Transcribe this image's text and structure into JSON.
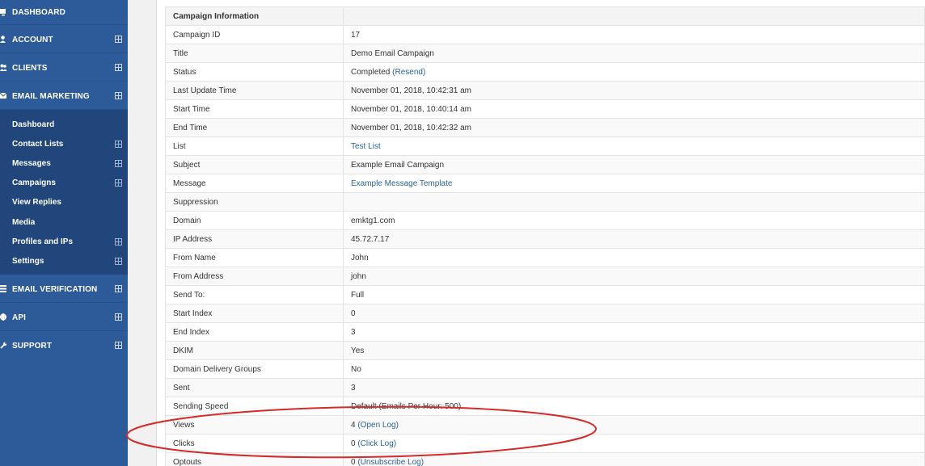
{
  "sidebar": {
    "top_items": [
      {
        "label": "DASHBOARD"
      },
      {
        "label": "ACCOUNT"
      },
      {
        "label": "CLIENTS"
      },
      {
        "label": "EMAIL MARKETING"
      }
    ],
    "sub_items": [
      {
        "label": "Dashboard"
      },
      {
        "label": "Contact Lists"
      },
      {
        "label": "Messages"
      },
      {
        "label": "Campaigns"
      },
      {
        "label": "View Replies"
      },
      {
        "label": "Media"
      },
      {
        "label": "Profiles and IPs"
      },
      {
        "label": "Settings"
      }
    ],
    "bottom_items": [
      {
        "label": "EMAIL VERIFICATION"
      },
      {
        "label": "API"
      },
      {
        "label": "SUPPORT"
      }
    ]
  },
  "campaign": {
    "header": "Campaign Information",
    "rows": [
      {
        "key": "Campaign ID",
        "value": "17"
      },
      {
        "key": "Title",
        "value": "Demo Email Campaign"
      },
      {
        "key": "Status",
        "value": "Completed",
        "link": "(Resend)"
      },
      {
        "key": "Last Update Time",
        "value": "November 01, 2018, 10:42:31 am"
      },
      {
        "key": "Start Time",
        "value": "November 01, 2018, 10:40:14 am"
      },
      {
        "key": "End Time",
        "value": "November 01, 2018, 10:42:32 am"
      },
      {
        "key": "List",
        "link": "Test List"
      },
      {
        "key": "Subject",
        "value": "Example Email Campaign"
      },
      {
        "key": "Message",
        "link": "Example Message Template"
      },
      {
        "key": "Suppression",
        "value": ""
      },
      {
        "key": "Domain",
        "value": "emktg1.com"
      },
      {
        "key": "IP Address",
        "value": "45.72.7.17"
      },
      {
        "key": "From Name",
        "value": "John"
      },
      {
        "key": "From Address",
        "value": "john"
      },
      {
        "key": "Send To:",
        "value": "Full"
      },
      {
        "key": "Start Index",
        "value": "0"
      },
      {
        "key": "End Index",
        "value": "3"
      },
      {
        "key": "DKIM",
        "value": "Yes"
      },
      {
        "key": "Domain Delivery Groups",
        "value": "No"
      },
      {
        "key": "Sent",
        "value": "3"
      },
      {
        "key": "Sending Speed",
        "value": "Default (Emails Per Hour: 500)"
      },
      {
        "key": "Views",
        "value": "4",
        "link": "(Open Log)"
      },
      {
        "key": "Clicks",
        "value": "0",
        "link": "(Click Log)"
      },
      {
        "key": "Optouts",
        "value": "0",
        "link": "(Unsubscribe Log)"
      }
    ]
  },
  "colors": {
    "sidebar": "#2d5b99",
    "submenu": "#21467c",
    "link": "#2a6496",
    "annotation": "#d42a2a"
  }
}
